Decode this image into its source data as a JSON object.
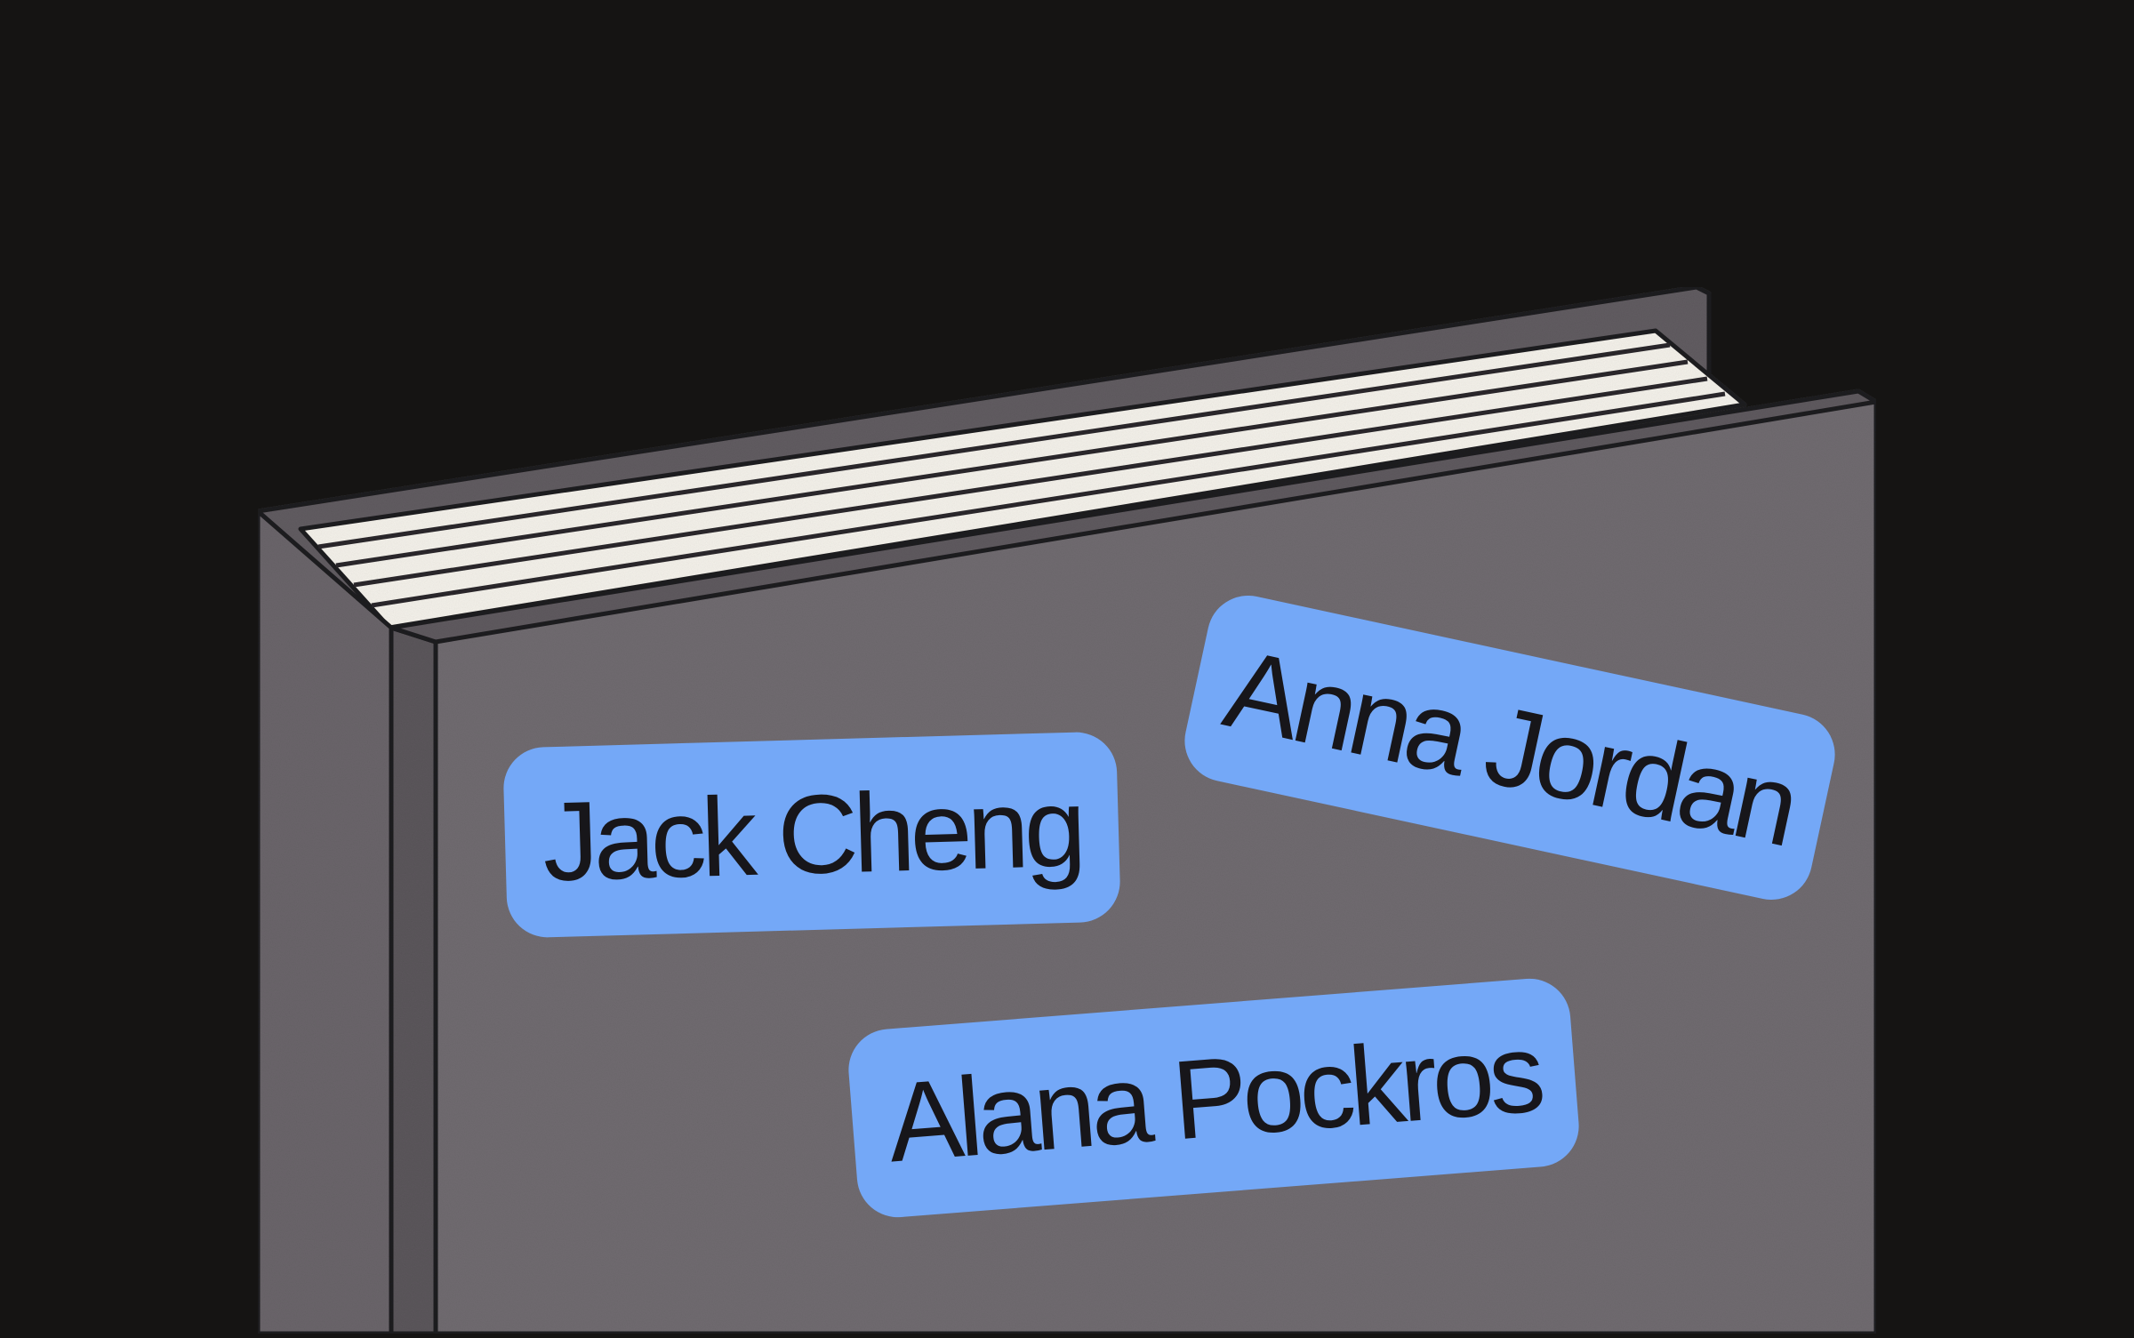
{
  "scene": {
    "subject": "book-with-name-tags",
    "colors": {
      "background": "#151413",
      "cover": "#6f6a6f",
      "cover_edge": "#5d585d",
      "pages": "#f4f1ea",
      "outline": "#1f1d20",
      "tag": "#74a8f7",
      "tag_text": "#17161a"
    }
  },
  "tags": [
    {
      "label": "Jack Cheng"
    },
    {
      "label": "Anna Jordan"
    },
    {
      "label": "Alana Pockros"
    }
  ]
}
